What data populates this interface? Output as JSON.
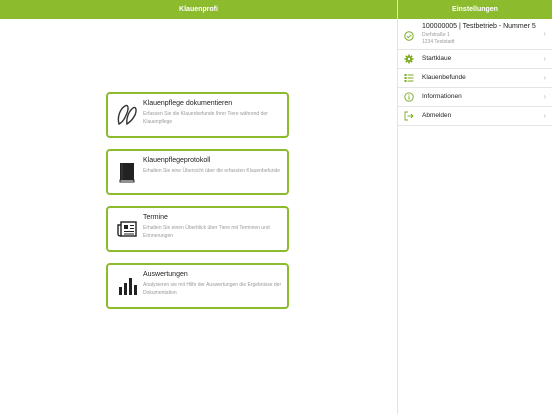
{
  "header": {
    "left_title": "Klauenprofi",
    "right_title": "Einstellungen"
  },
  "cards": [
    {
      "icon": "hoof-icon",
      "title": "Klauenpflege dokumentieren",
      "description": "Erfassen Sie die Klauenbefunde Ihrer Tiere während der Klauenpflege"
    },
    {
      "icon": "book-icon",
      "title": "Klauenpflegeprotokoll",
      "description": "Erhalten Sie eine Übersicht über die erfassten Klauenbefunde"
    },
    {
      "icon": "newspaper-icon",
      "title": "Termine",
      "description": "Erhalten Sie einen Überblick über Tiere mit Terminen und Erinnerungen"
    },
    {
      "icon": "bar-chart-icon",
      "title": "Auswertungen",
      "description": "Analysieren sie mit Hilfe der Auswertungen die Ergebnisse der Dokumentation"
    }
  ],
  "settings": {
    "organization": {
      "name": "100000005 | Testbetrieb - Nummer 5",
      "street": "Dorfstraße 1",
      "city": "1234 Teststadt"
    },
    "menu": [
      {
        "icon": "gear-icon",
        "label": "Startklaue"
      },
      {
        "icon": "list-icon",
        "label": "Klauenbefunde"
      },
      {
        "icon": "info-icon",
        "label": "Informationen"
      },
      {
        "icon": "logout-icon",
        "label": "Abmelden"
      }
    ]
  },
  "colors": {
    "accent": "#8cbb2e",
    "icon_green": "#7aab1f"
  }
}
